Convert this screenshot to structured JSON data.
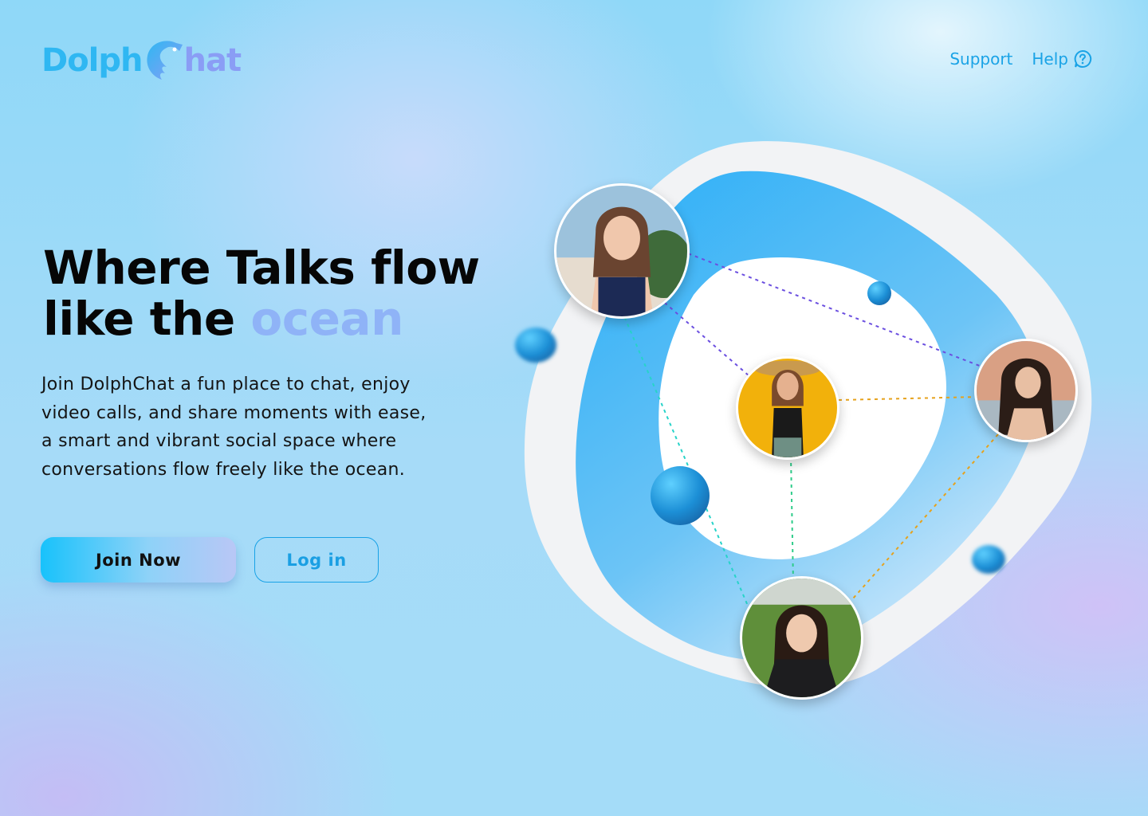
{
  "brand": {
    "name_part1": "Dolph",
    "name_part2": "hat",
    "icon": "dolphin-c-icon",
    "colors": {
      "primary": "#2fb7f2",
      "secondary": "#8a9df5"
    }
  },
  "nav": {
    "support_label": "Support",
    "help_label": "Help",
    "help_icon": "question-circle-icon"
  },
  "hero": {
    "title_line1": "Where Talks flow",
    "title_line2_prefix": "like the ",
    "title_line2_accent": "ocean",
    "description": "Join DolphChat a fun place to chat, enjoy video calls, and share moments with ease, a smart and vibrant social space where conversations flow freely like the ocean.",
    "join_label": "Join Now",
    "login_label": "Log in"
  },
  "network": {
    "avatars": [
      {
        "id": "avatar-top-left",
        "background": "#7aa9c9"
      },
      {
        "id": "avatar-center",
        "background": "#f2b10b"
      },
      {
        "id": "avatar-right",
        "background": "#d9a084"
      },
      {
        "id": "avatar-bottom",
        "background": "#5f8f3a"
      }
    ],
    "connection_colors": [
      "#6b4fe0",
      "#27d3c9",
      "#e6a21c",
      "#2ecc8a"
    ]
  }
}
